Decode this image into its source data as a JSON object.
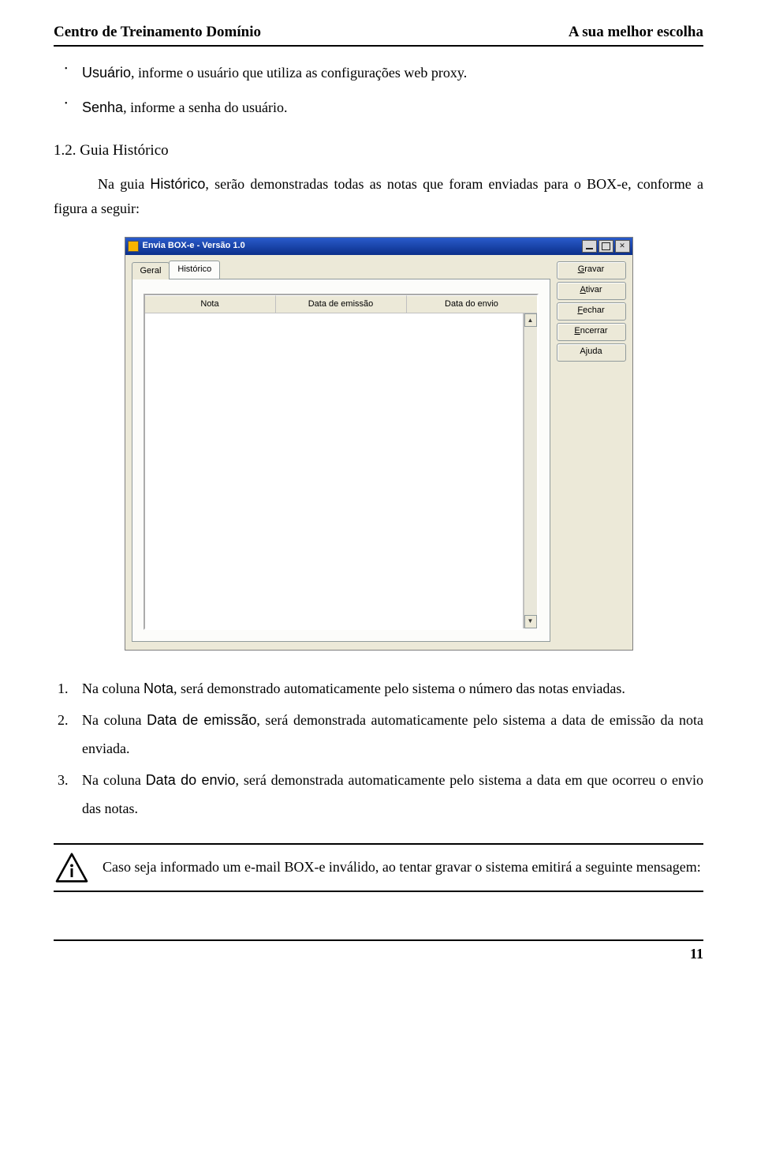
{
  "header": {
    "left": "Centro de Treinamento Domínio",
    "right": "A sua melhor escolha"
  },
  "bullets": {
    "usuario_label": "Usuário",
    "usuario_text": ", informe o usuário que utiliza as configurações web proxy.",
    "senha_label": "Senha",
    "senha_text": ", informe a senha do usuário."
  },
  "section": {
    "number": "1.2. Guia Histórico",
    "intro_pre": "Na guia ",
    "intro_kw": "Histórico",
    "intro_post": ", serão demonstradas todas as notas que foram enviadas para o BOX-e, conforme a figura a seguir:"
  },
  "window": {
    "title": "Envia BOX-e - Versão 1.0",
    "tabs": {
      "geral": "Geral",
      "historico": "Histórico"
    },
    "columns": {
      "nota": "Nota",
      "data_emissao": "Data de emissão",
      "data_envio": "Data do envio"
    },
    "buttons": {
      "gravar": "ravar",
      "gravar_mn": "G",
      "ativar": "tivar",
      "ativar_mn": "A",
      "fechar": "echar",
      "fechar_mn": "F",
      "encerrar": "ncerrar",
      "encerrar_mn": "E",
      "ajuda": "uda",
      "ajuda_mn": "j",
      "ajuda_pre": "A"
    }
  },
  "numbered": {
    "n1_pre": "Na coluna ",
    "n1_kw": "Nota",
    "n1_post": ", será demonstrado automaticamente pelo sistema o número das notas enviadas.",
    "n2_pre": "Na coluna ",
    "n2_kw": "Data de emissão",
    "n2_post": ", será demonstrada automaticamente pelo sistema a data de emissão da nota enviada.",
    "n3_pre": "Na coluna ",
    "n3_kw": "Data do envio",
    "n3_post": ", será demonstrada automaticamente pelo sistema a data em que ocorreu o envio das notas."
  },
  "info": "Caso seja informado um e-mail BOX-e inválido, ao tentar gravar o sistema emitirá a seguinte mensagem:",
  "page_number": "11"
}
